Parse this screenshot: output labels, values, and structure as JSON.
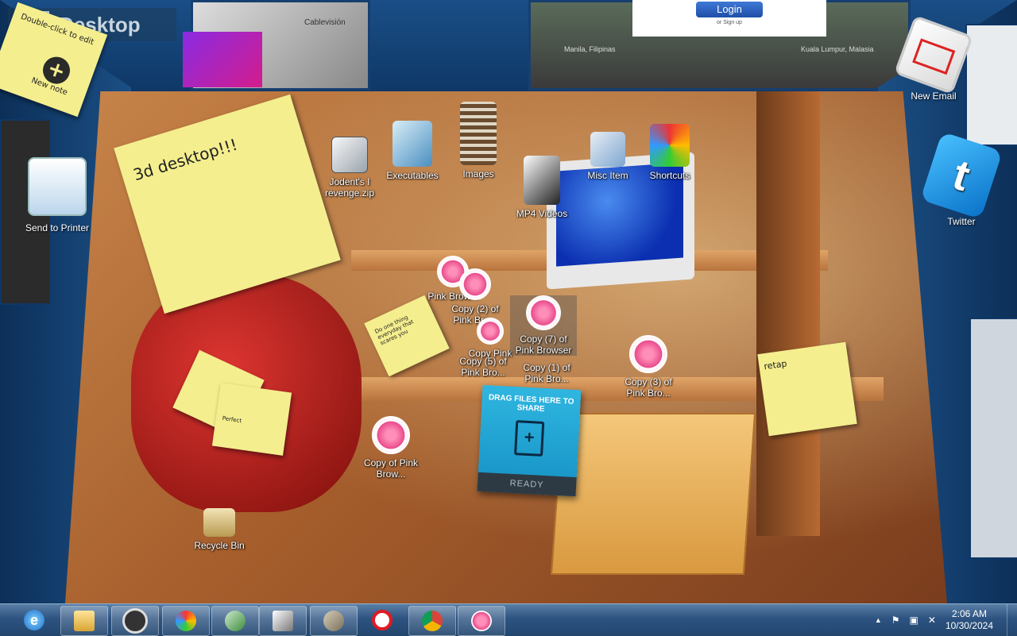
{
  "desktop_title": "Desktop",
  "notes": {
    "new_note_text": "New note",
    "new_note_hint": "Double-click to edit",
    "main": "3d desktop!!!",
    "retap": "retap",
    "small": "Do one thing everyday that scares you",
    "chair_a": "",
    "chair_b": "Perfect"
  },
  "side_apps": {
    "new_email": "New Email",
    "twitter": "Twitter",
    "send_to_printer": "Send to Printer"
  },
  "login": {
    "button": "Login",
    "sub": "or Sign up"
  },
  "geo": {
    "left": "Manila, Filipinas",
    "right": "Kuala Lumpur, Malasia"
  },
  "ceiling_text": "Cablevisión",
  "icons": {
    "torrent": "Jodent's I revenge.zip",
    "executables": "Executables",
    "images": "Images",
    "misc": "Misc Item",
    "shortcuts": "Shortcuts",
    "mp4": "MP4 Videos",
    "recycle": "Recycle Bin",
    "pink_copy2": "Copy (2) of Pink Bro...",
    "pink_copy7": "Copy (7) of Pink Browser",
    "pink_copy5": "Copy (5) of Pink Bro...",
    "pink_copy1": "Copy (1) of Pink Bro...",
    "pink_copy3": "Copy (3) of Pink Bro...",
    "pink_copy": "Copy of Pink Brow...",
    "pink_plain": "Pink Brow...",
    "pink_partial": "Copy Pink"
  },
  "share_widget": {
    "title": "DRAG FILES HERE TO SHARE",
    "status": "READY"
  },
  "taskbar": {
    "apps": [
      "ie-icon",
      "explorer-icon",
      "media-icon",
      "multicolor-app-icon",
      "maps-app-icon",
      "card-app-icon",
      "gimp-icon",
      "opera-icon",
      "chrome-icon",
      "pink-browser-icon"
    ],
    "time": "2:06 AM",
    "date": "10/30/2024",
    "tray_arrow": "▲"
  },
  "colors": {
    "note": "#f4ee8e",
    "taskbar": "#2d5381",
    "share": "#1591c4"
  }
}
